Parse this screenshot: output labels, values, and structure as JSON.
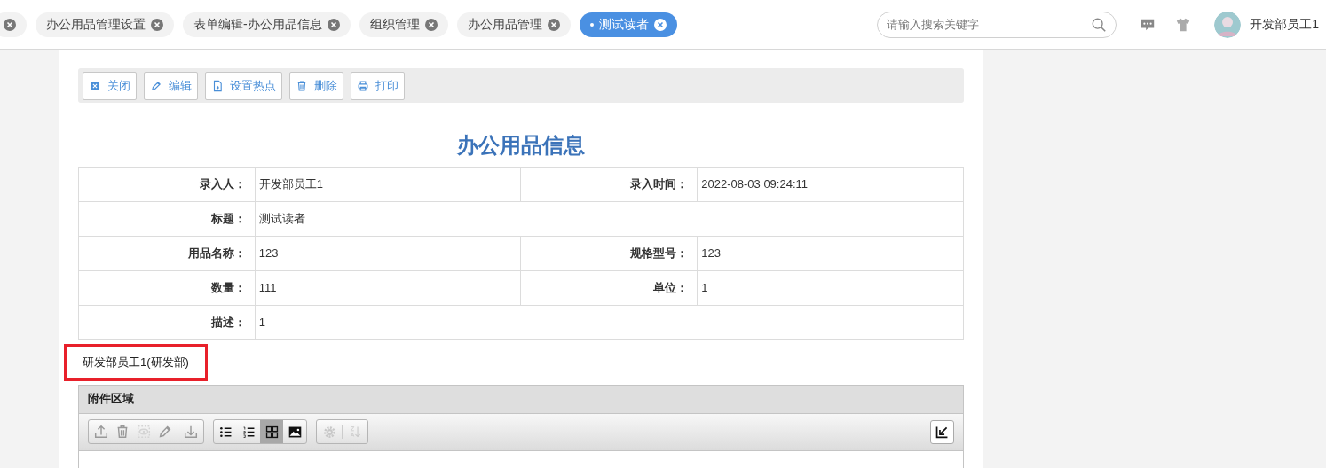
{
  "tabs": [
    {
      "selected": false
    },
    {
      "label": "办公用品管理设置",
      "selected": false
    },
    {
      "label": "表单编辑-办公用品信息",
      "selected": false
    },
    {
      "label": "组织管理",
      "selected": false
    },
    {
      "label": "办公用品管理",
      "selected": false
    },
    {
      "label": "测试读者",
      "selected": true
    }
  ],
  "search": {
    "placeholder": "请输入搜索关键字"
  },
  "user": {
    "name": "开发部员工1"
  },
  "toolbar": [
    {
      "kind": "close",
      "label": "关闭"
    },
    {
      "kind": "edit",
      "label": "编辑"
    },
    {
      "kind": "hotspot",
      "label": "设置热点"
    },
    {
      "kind": "delete",
      "label": "删除"
    },
    {
      "kind": "print",
      "label": "打印"
    }
  ],
  "form": {
    "title": "办公用品信息",
    "rows": [
      [
        {
          "label": "录入人：",
          "value": "开发部员工1"
        },
        {
          "label": "录入时间：",
          "value": "2022-08-03 09:24:11"
        }
      ],
      [
        {
          "label": "标题：",
          "value": "测试读者"
        }
      ],
      [
        {
          "label": "用品名称：",
          "value": "123"
        },
        {
          "label": "规格型号：",
          "value": "123"
        }
      ],
      [
        {
          "label": "数量：",
          "value": "111"
        },
        {
          "label": "单位：",
          "value": "1"
        }
      ],
      [
        {
          "label": "描述：",
          "value": "1"
        }
      ]
    ]
  },
  "signature": {
    "text": "研发部员工1(研发部)",
    "highlighted": true
  },
  "attachments": {
    "title": "附件区域",
    "actions": [
      {
        "kind": "upload",
        "disabled": false
      },
      {
        "kind": "delete",
        "disabled": false
      },
      {
        "kind": "view",
        "disabled": true
      },
      {
        "kind": "edit",
        "disabled": false
      },
      {
        "kind": "download",
        "disabled": false
      }
    ],
    "views": [
      {
        "kind": "list",
        "selected": false
      },
      {
        "kind": "numbered",
        "selected": false
      },
      {
        "kind": "grid",
        "selected": true
      },
      {
        "kind": "image",
        "selected": false
      }
    ],
    "tools": [
      {
        "kind": "settings",
        "disabled": true
      },
      {
        "kind": "sort",
        "disabled": true
      }
    ]
  }
}
